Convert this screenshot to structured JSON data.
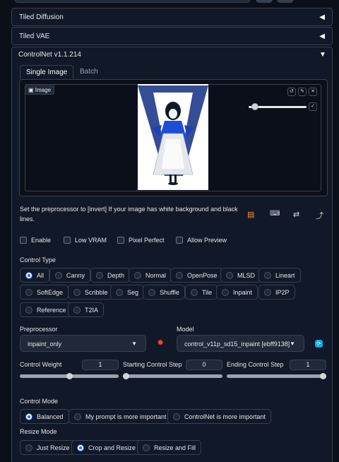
{
  "accordions": [
    {
      "label": "Tiled Diffusion",
      "arrow": "◀"
    },
    {
      "label": "Tiled VAE",
      "arrow": "◀"
    }
  ],
  "controlnet": {
    "title": "ControlNet v1.1.214",
    "arrow": "▼",
    "tabs": [
      "Single Image",
      "Batch"
    ],
    "image_label": "Image",
    "info_text": "Set the preprocessor to [invert] If your image has white background and black lines.",
    "checkboxes": [
      "Enable",
      "Low VRAM",
      "Pixel Perfect",
      "Allow Preview"
    ],
    "control_type_label": "Control Type",
    "control_types": [
      "All",
      "Canny",
      "Depth",
      "Normal",
      "OpenPose",
      "MLSD",
      "Lineart",
      "SoftEdge",
      "Scribble",
      "Seg",
      "Shuffle",
      "Tile",
      "Inpaint",
      "IP2P",
      "Reference",
      "T2IA"
    ],
    "control_type_selected": "All",
    "preprocessor_label": "Preprocessor",
    "preprocessor_value": "inpaint_only",
    "model_label": "Model",
    "model_value": "control_v11p_sd15_inpaint [ebff9138]",
    "weight_label": "Control Weight",
    "weight_value": "1",
    "start_label": "Starting Control Step",
    "start_value": "0",
    "end_label": "Ending Control Step",
    "end_value": "1",
    "weight_fraction": 0.5,
    "start_fraction": 0.0,
    "end_fraction": 1.0,
    "control_mode_label": "Control Mode",
    "control_modes": [
      "Balanced",
      "My prompt is more important",
      "ControlNet is more important"
    ],
    "control_mode_selected": "Balanced",
    "resize_mode_label": "Resize Mode",
    "resize_modes": [
      "Just Resize",
      "Crop and Resize",
      "Resize and Fill"
    ],
    "resize_mode_selected": "Crop and Resize"
  },
  "colors": {
    "accent": "#2563eb",
    "background": "#0b0f19",
    "panel": "#111827"
  }
}
